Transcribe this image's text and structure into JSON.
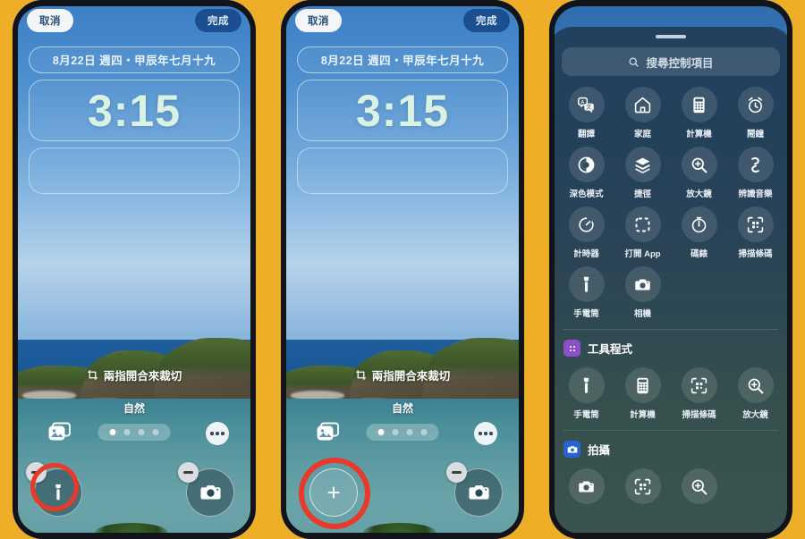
{
  "background_color": "#EFAE28",
  "phones": [
    {
      "id": "phone-edit-1",
      "topbar": {
        "cancel": "取消",
        "done": "完成"
      },
      "lockscreen": {
        "date": "8月22日 週四・甲辰年七月十九",
        "time": "3:15",
        "crop_hint": "兩指開合來裁切",
        "style_label": "自然",
        "page_dots": 4,
        "active_dot": 0
      },
      "controls": {
        "left": {
          "icon": "flashlight-icon",
          "badge": "minus",
          "highlighted": true
        },
        "right": {
          "icon": "camera-icon",
          "badge": "minus",
          "highlighted": false
        }
      }
    },
    {
      "id": "phone-edit-2",
      "topbar": {
        "cancel": "取消",
        "done": "完成"
      },
      "lockscreen": {
        "date": "8月22日 週四・甲辰年七月十九",
        "time": "3:15",
        "crop_hint": "兩指開合來裁切",
        "style_label": "自然",
        "page_dots": 4,
        "active_dot": 0
      },
      "controls": {
        "left": {
          "icon": "plus-icon",
          "badge": "none",
          "highlighted": true
        },
        "right": {
          "icon": "camera-icon",
          "badge": "minus",
          "highlighted": false
        }
      }
    }
  ],
  "control_center": {
    "search": {
      "placeholder": "搜尋控制項目",
      "icon": "search-icon"
    },
    "grid": [
      {
        "label": "翻譯",
        "icon": "translate-icon"
      },
      {
        "label": "家庭",
        "icon": "home-icon"
      },
      {
        "label": "計算機",
        "icon": "calculator-icon"
      },
      {
        "label": "鬧鐘",
        "icon": "alarm-icon"
      },
      {
        "label": "深色模式",
        "icon": "dark-mode-icon"
      },
      {
        "label": "捷徑",
        "icon": "shortcuts-icon"
      },
      {
        "label": "放大鏡",
        "icon": "magnifier-icon"
      },
      {
        "label": "辨識音樂",
        "icon": "shazam-icon"
      },
      {
        "label": "計時器",
        "icon": "timer-icon"
      },
      {
        "label": "打開 App",
        "icon": "open-app-icon"
      },
      {
        "label": "碼錶",
        "icon": "stopwatch-icon"
      },
      {
        "label": "掃描條碼",
        "icon": "scan-code-icon"
      },
      {
        "label": "手電筒",
        "icon": "flashlight-icon"
      },
      {
        "label": "相機",
        "icon": "camera-icon"
      }
    ],
    "sections": [
      {
        "title": "工具程式",
        "icon": "grid-dots-icon",
        "color": "#8b4fc7",
        "items": [
          {
            "label": "手電筒",
            "icon": "flashlight-icon"
          },
          {
            "label": "計算機",
            "icon": "calculator-icon"
          },
          {
            "label": "掃描條碼",
            "icon": "scan-code-icon"
          },
          {
            "label": "放大鏡",
            "icon": "magnifier-icon"
          }
        ]
      },
      {
        "title": "拍攝",
        "icon": "camera-icon",
        "color": "#2563d6",
        "items": [
          {
            "label": "",
            "icon": "camera-icon"
          },
          {
            "label": "",
            "icon": "scan-code-icon"
          },
          {
            "label": "",
            "icon": "magnifier-icon"
          }
        ]
      }
    ]
  }
}
